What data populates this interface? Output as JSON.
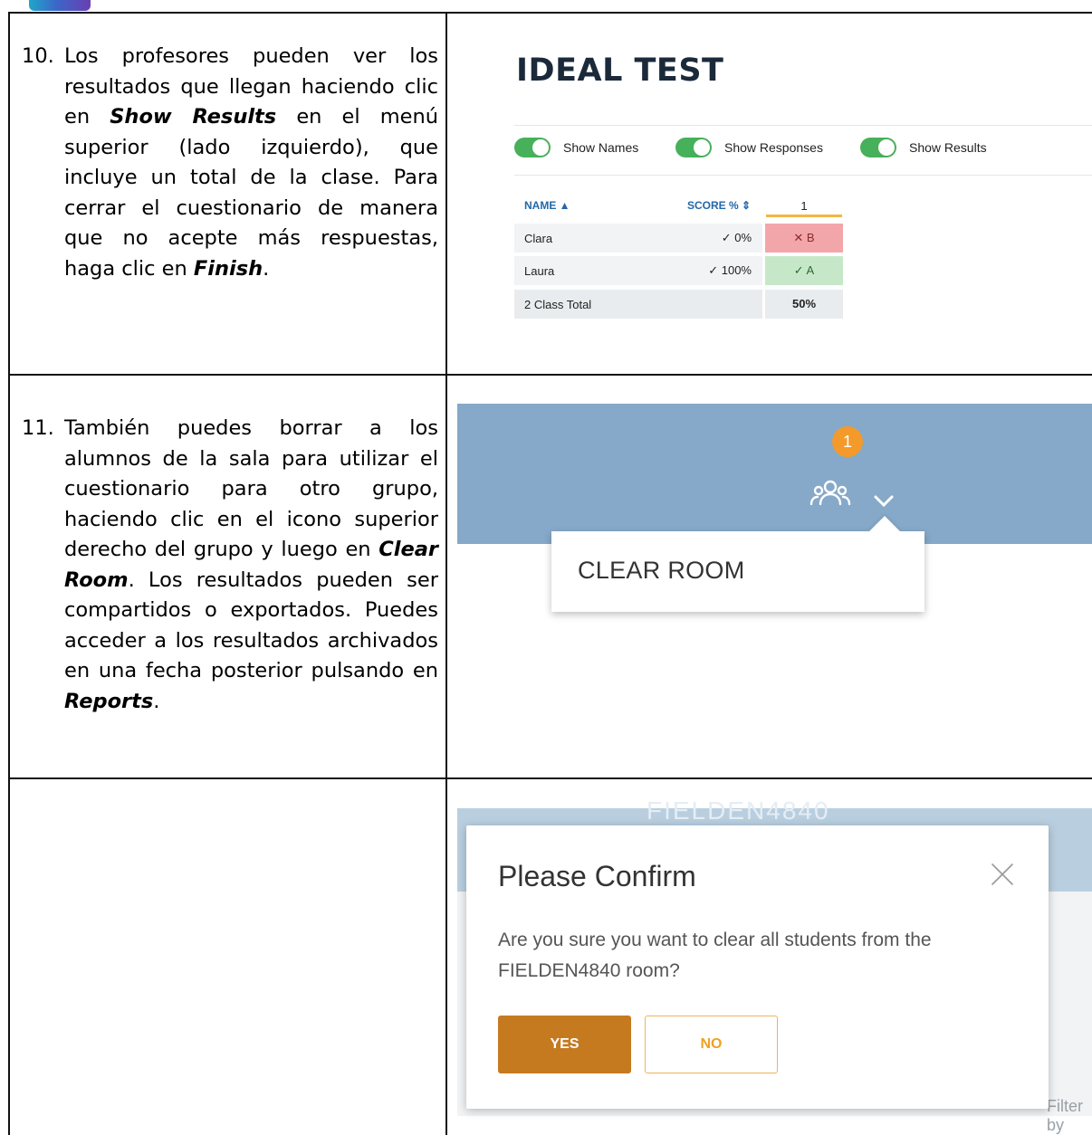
{
  "row1": {
    "number": "10.",
    "text_a": "Los profesores pueden ver los resultados que llegan haciendo clic en ",
    "bold_a": "Show Results",
    "text_b": " en el menú superior (lado izquierdo), que incluye un total de la clase. Para cerrar el cuestionario de manera que no acepte más respuestas, haga clic en ",
    "bold_b": "Finish",
    "text_c": "."
  },
  "row2": {
    "number": "11.",
    "text_a": "También puedes borrar a los alumnos de la sala para utilizar el cuestionario para otro grupo, haciendo clic en el icono superior derecho del grupo y luego en ",
    "bold_a": "Clear Room",
    "text_b": ". Los resultados pueden ser compartidos o exportados. Puedes acceder a los resultados archivados en una fecha posterior pulsando en ",
    "bold_b": "Reports",
    "text_c": "."
  },
  "ideal_test": {
    "title": "IDEAL TEST",
    "toggles": [
      "Show Names",
      "Show Responses",
      "Show Results"
    ],
    "headers": {
      "name": "NAME ▲",
      "score": "SCORE % ⇕",
      "question": "1"
    },
    "rows": [
      {
        "name": "Clara",
        "score": "✓ 0%",
        "answer": "✕ B",
        "answer_color": "#f3a6a9"
      },
      {
        "name": "Laura",
        "score": "✓ 100%",
        "answer": "✓ A",
        "answer_color": "#c6e8c8"
      }
    ],
    "total": {
      "label": "2  Class Total",
      "value": "50%"
    }
  },
  "clear_room": {
    "badge": "1",
    "menu_item": "CLEAR ROOM",
    "header_color": "#86a9c9"
  },
  "confirm": {
    "bg_title": "FIELDEN4840",
    "title": "Please Confirm",
    "message": "Are you sure you want to clear all students from the FIELDEN4840 room?",
    "yes": "YES",
    "no": "NO",
    "filter": "Filter by"
  }
}
